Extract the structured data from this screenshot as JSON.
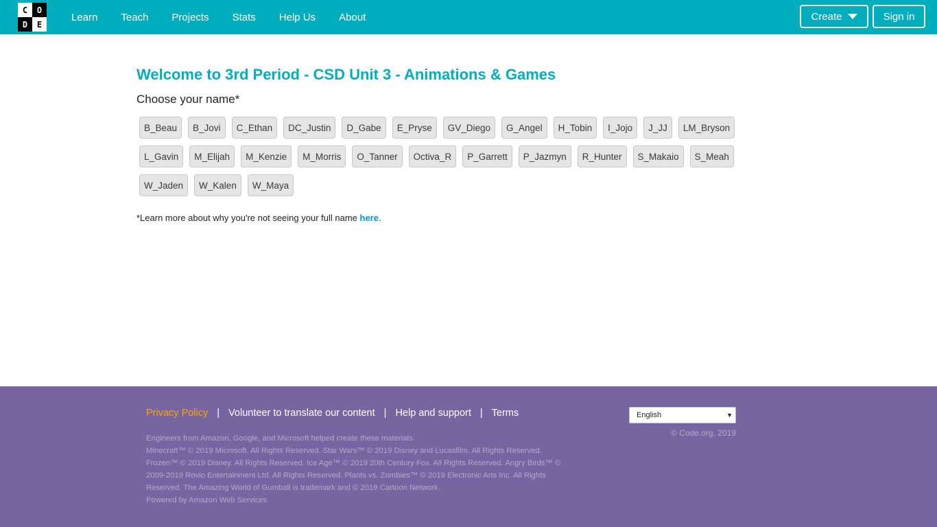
{
  "header": {
    "logo_letters": [
      "C",
      "O",
      "D",
      "E"
    ],
    "nav": [
      "Learn",
      "Teach",
      "Projects",
      "Stats",
      "Help Us",
      "About"
    ],
    "create_label": "Create",
    "signin_label": "Sign in",
    "bar_color": "#00adbc"
  },
  "main": {
    "title": "Welcome to 3rd Period - CSD Unit 3 - Animations & Games",
    "subtitle": "Choose your name*",
    "names": [
      "B_Beau",
      "B_Jovi",
      "C_Ethan",
      "DC_Justin",
      "D_Gabe",
      "E_Pryse",
      "GV_Diego",
      "G_Angel",
      "H_Tobin",
      "I_Jojo",
      "J_JJ",
      "LM_Bryson",
      "L_Gavin",
      "M_Elijah",
      "M_Kenzie",
      "M_Morris",
      "O_Tanner",
      "Octiva_R",
      "P_Garrett",
      "P_Jazmyn",
      "R_Hunter",
      "S_Makaio",
      "S_Meah",
      "W_Jaden",
      "W_Kalen",
      "W_Maya"
    ],
    "note_prefix": "*Learn more about why you're not seeing your full name ",
    "note_link": "here",
    "note_suffix": "."
  },
  "footer": {
    "links": [
      "Privacy Policy",
      "Volunteer to translate our content",
      "Help and support",
      "Terms"
    ],
    "separator": "|",
    "legal": [
      "Engineers from Amazon, Google, and Microsoft helped create these materials.",
      "Minecraft™ © 2019 Microsoft. All Rights Reserved. Star Wars™ © 2019 Disney and Lucasfilm. All Rights Reserved. Frozen™ © 2019 Disney. All Rights Reserved. Ice Age™ © 2019 20th Century Fox. All Rights Reserved. Angry Birds™ © 2009-2019 Rovio Entertainment Ltd. All Rights Reserved. Plants vs. Zombies™ © 2019 Electronic Arts Inc. All Rights Reserved. The Amazing World of Gumball is trademark and © 2019 Cartoon Network.",
      "Powered by Amazon Web Services"
    ],
    "language": "English",
    "copyright": "© Code.org, 2019",
    "bg_color": "#7665a0",
    "privacy_color": "#ffa400"
  }
}
